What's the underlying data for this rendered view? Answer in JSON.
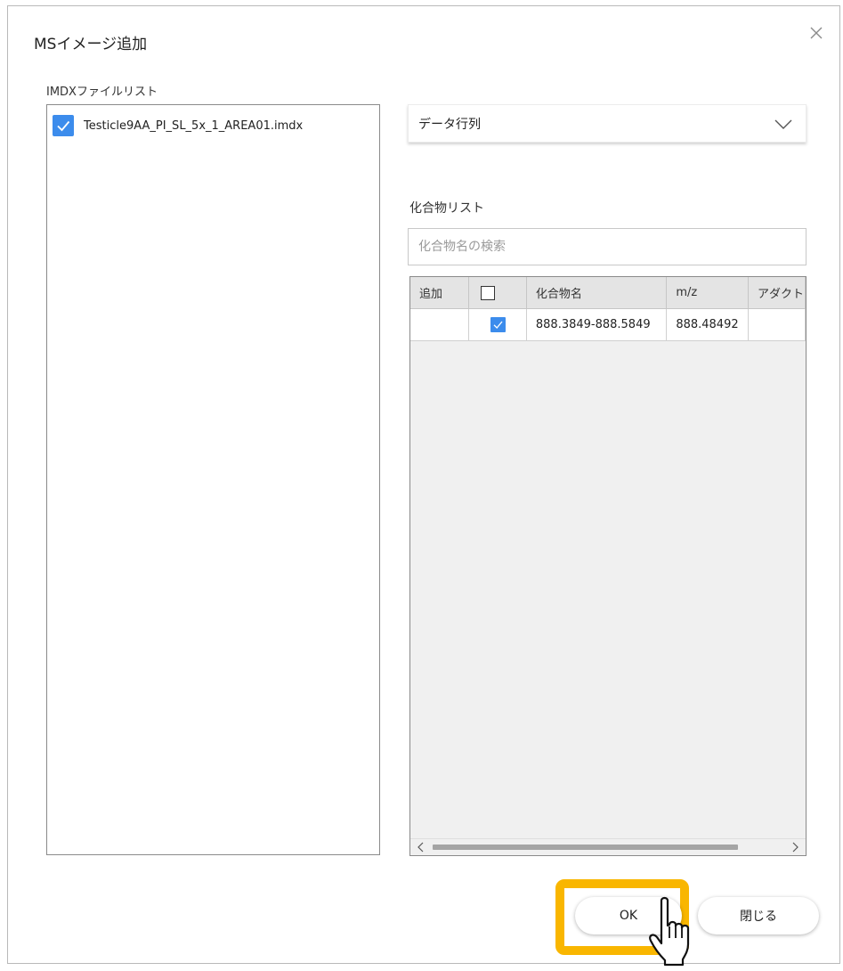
{
  "dialog": {
    "title": "MSイメージ追加"
  },
  "file_list": {
    "label": "IMDXファイルリスト",
    "items": [
      {
        "name": "Testicle9AA_PI_SL_5x_1_AREA01.imdx",
        "checked": true
      }
    ]
  },
  "dropdown": {
    "selected": "データ行列"
  },
  "compound_list": {
    "label": "化合物リスト",
    "search_placeholder": "化合物名の検索",
    "columns": [
      "追加",
      "",
      "化合物名",
      "m/z",
      "アダクト"
    ],
    "rows": [
      {
        "add": "",
        "checked": true,
        "name": "888.3849-888.5849",
        "mz": "888.48492",
        "adduct": ""
      }
    ]
  },
  "buttons": {
    "ok": "OK",
    "close": "閉じる"
  },
  "colors": {
    "accent": "#3c8cec",
    "highlight": "#f9b600"
  },
  "icons": {
    "close": "close-icon",
    "dropdown": "chevron-down-icon",
    "check": "checkmark-icon",
    "cursor": "hand-pointer-icon"
  }
}
